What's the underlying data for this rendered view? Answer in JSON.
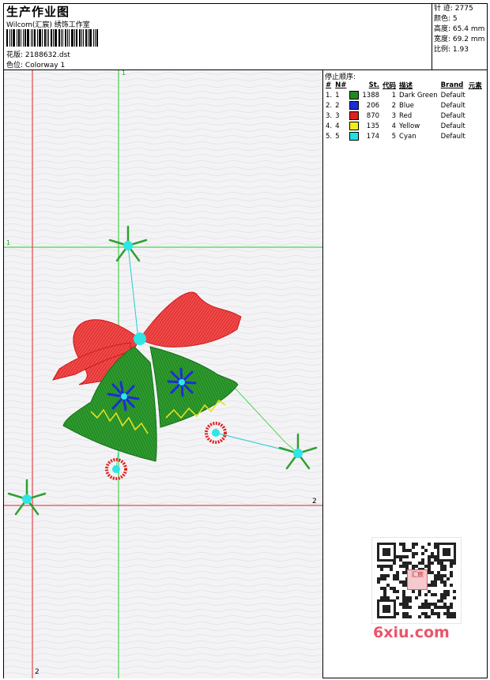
{
  "header": {
    "title": "生产作业图",
    "studio": "Wilcom(汇宸) 绣饰工作室",
    "design_label": "花版:",
    "design_value": "2188632.dst",
    "colorway_label": "色位:",
    "colorway_value": "Colorway 1"
  },
  "stats": [
    {
      "label": "针 迹:",
      "value": "2775"
    },
    {
      "label": "颜色:",
      "value": "5"
    },
    {
      "label": "高度:",
      "value": "65.4 mm"
    },
    {
      "label": "宽度:",
      "value": "69.2 mm"
    },
    {
      "label": "比例:",
      "value": "1.93"
    }
  ],
  "canvas": {
    "marker_1_top": "1",
    "marker_1_left": "1",
    "marker_2_right": "2",
    "marker_2_bottom": "2"
  },
  "stop_sequence": {
    "title": "停止顺序:",
    "headers": [
      "#",
      "N#",
      "St.",
      "代码",
      "描述",
      "Brand",
      "元素"
    ],
    "rows": [
      {
        "num": "1.",
        "n": "1",
        "st": "1388",
        "code": "1",
        "desc": "Dark Green",
        "brand": "Default",
        "color": "#1e8a1e"
      },
      {
        "num": "2.",
        "n": "2",
        "st": "206",
        "code": "2",
        "desc": "Blue",
        "brand": "Default",
        "color": "#1a2fd6"
      },
      {
        "num": "3.",
        "n": "3",
        "st": "870",
        "code": "3",
        "desc": "Red",
        "brand": "Default",
        "color": "#e02020"
      },
      {
        "num": "4.",
        "n": "4",
        "st": "135",
        "code": "4",
        "desc": "Yellow",
        "brand": "Default",
        "color": "#f2ee1a"
      },
      {
        "num": "5.",
        "n": "5",
        "st": "174",
        "code": "5",
        "desc": "Cyan",
        "brand": "Default",
        "color": "#1ee0e0"
      }
    ]
  },
  "watermark": {
    "qr_badge": "汇宸",
    "site": "6xiu.com"
  }
}
